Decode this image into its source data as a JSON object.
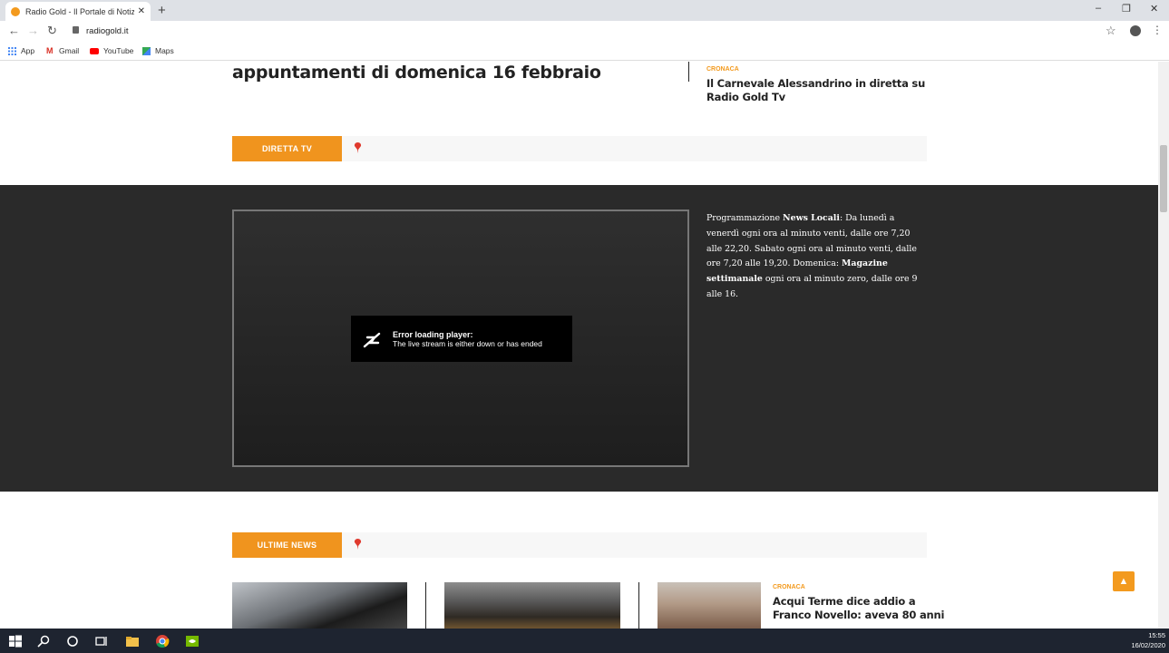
{
  "browser": {
    "tab_title": "Radio Gold - Il Portale di Notizie",
    "tab_close": "✕",
    "new_tab": "+",
    "url": "radiogold.it",
    "bookmarks": [
      "App",
      "Gmail",
      "YouTube",
      "Maps"
    ],
    "window_controls": [
      "–",
      "❐",
      "✕"
    ]
  },
  "page": {
    "top_article_title": "appuntamenti di domenica 16 febbraio",
    "side_article": {
      "category": "CRONACA",
      "title_line1": "Il Carnevale Alessandrino in diretta su",
      "title_line2": "Radio Gold Tv"
    },
    "diretta_label": "DIRETTA TV",
    "player": {
      "error_title": "Error loading player:",
      "error_message": "The live stream is either down or has ended"
    },
    "schedule": {
      "p1": "Programmazione ",
      "b1": "News Locali",
      "p2": ": Da lunedì a venerdì ogni ora al minuto venti, dalle ore 7,20 alle 22,20. Sabato ogni ora al minuto venti, dalle ore 7,20 alle 19,20. Domenica: ",
      "b2": "Magazine settimanale",
      "p3": " ogni ora al minuto zero, dalle ore 9 alle 16."
    },
    "ultime_label": "ULTIME NEWS",
    "news_card": {
      "category": "CRONACA",
      "title_line1": "Acqui Terme dice addio a",
      "title_line2": "Franco Novello: aveva 80 anni"
    },
    "to_top": "▲"
  },
  "taskbar": {
    "time": "15:55",
    "date": "16/02/2020"
  },
  "colors": {
    "accent": "#f39a1e",
    "dark_band": "#2a2a2a"
  }
}
